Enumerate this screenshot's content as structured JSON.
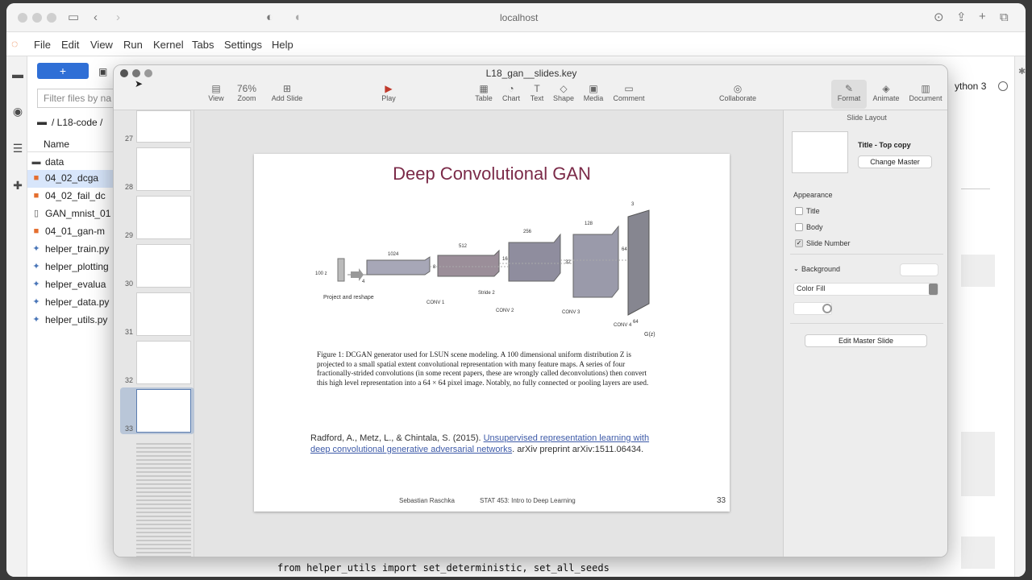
{
  "browser": {
    "url": "localhost"
  },
  "jupyter": {
    "menu": [
      "File",
      "Edit",
      "View",
      "Run",
      "Kernel",
      "Tabs",
      "Settings",
      "Help"
    ],
    "new_button": "+",
    "filter_placeholder": "Filter files by na",
    "breadcrumb": "/ L18-code /",
    "column_name": "Name",
    "files": [
      "data",
      "04_02_dcga",
      "04_02_fail_dc",
      "GAN_mnist_01",
      "04_01_gan-m",
      "helper_train.py",
      "helper_plotting",
      "helper_evalua",
      "helper_data.py",
      "helper_utils.py"
    ],
    "kernel": "ython 3",
    "code_line1": "from helper_utils import set_deterministic, set_all_seeds"
  },
  "keynote": {
    "title": "L18_gan__slides.key",
    "toolbar": [
      "View",
      "Zoom",
      "Add Slide",
      "Play",
      "Table",
      "Chart",
      "Text",
      "Shape",
      "Media",
      "Comment",
      "Collaborate",
      "Format",
      "Animate",
      "Document"
    ],
    "zoom_value": "76%",
    "slide_numbers": [
      "27",
      "28",
      "29",
      "30",
      "31",
      "32",
      "33"
    ],
    "slide": {
      "title": "Deep Convolutional GAN",
      "figure_labels": {
        "z": "100 z",
        "project": "Project and reshape",
        "d1024": "1024",
        "d512": "512",
        "d256": "256",
        "d128": "128",
        "d3": "3",
        "d64": "64",
        "d4": "4",
        "d8": "8",
        "d16": "16",
        "d32": "32",
        "stride": "Stride 2",
        "conv1": "CONV 1",
        "conv2": "CONV 2",
        "conv3": "CONV 3",
        "conv4": "CONV 4",
        "gz": "G(z)"
      },
      "caption": "Figure 1: DCGAN generator used for LSUN scene modeling. A 100 dimensional uniform distribution Z is projected to a small spatial extent convolutional representation with many feature maps. A series of four fractionally-strided convolutions (in some recent papers, these are wrongly called deconvolutions) then convert this high level representation into a 64 × 64 pixel image. Notably, no fully connected or pooling layers are used.",
      "ref_authors": "Radford, A., Metz, L., & Chintala, S. (2015).",
      "ref_link": "Unsupervised representation learning with deep convolutional generative adversarial networks",
      "ref_rest": ". arXiv preprint arXiv:1511.06434.",
      "footer_author": "Sebastian Raschka",
      "footer_course": "STAT 453: Intro to Deep Learning",
      "page_number": "33"
    },
    "inspector": {
      "header": "Slide Layout",
      "layout_name": "Title - Top copy",
      "change_master": "Change Master",
      "appearance": "Appearance",
      "options": [
        "Title",
        "Body",
        "Slide Number"
      ],
      "background": "Background",
      "fill": "Color Fill",
      "edit_master": "Edit Master Slide"
    }
  }
}
